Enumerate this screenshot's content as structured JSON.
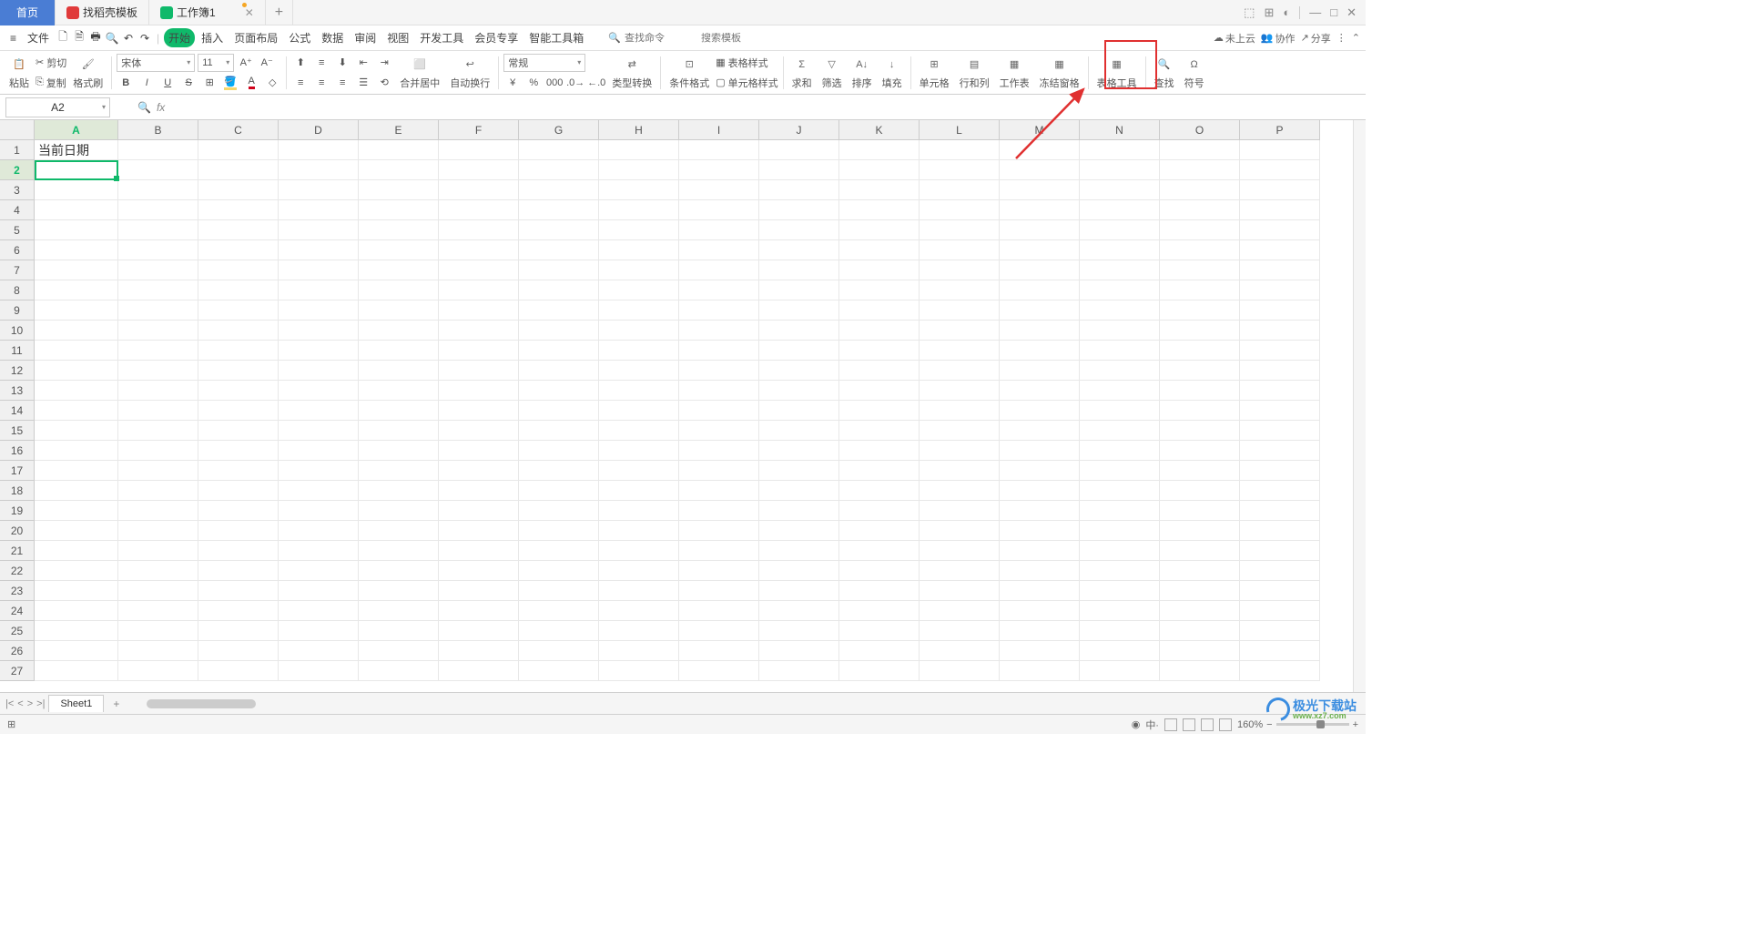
{
  "titlebar": {
    "tabs": {
      "home": "首页",
      "template_icon": "dk",
      "template": "找稻壳模板",
      "workbook_icon": "S",
      "workbook": "工作簿1",
      "add": "+"
    },
    "win": {
      "layout": "⬚",
      "grid": "⊞",
      "user": "◐",
      "min": "—",
      "max": "□",
      "close": "✕"
    }
  },
  "menubar": {
    "items": {
      "file": "文件",
      "start": "开始",
      "insert": "插入",
      "page": "页面布局",
      "formula": "公式",
      "data": "数据",
      "review": "审阅",
      "view": "视图",
      "devtools": "开发工具",
      "member": "会员专享",
      "smart": "智能工具箱"
    },
    "hamburger": "≡",
    "search": {
      "cmd_ph": "查找命令",
      "tpl_ph": "搜索模板"
    },
    "right": {
      "notcloud": "未上云",
      "collab": "协作",
      "share": "分享"
    }
  },
  "ribbon": {
    "paste": "粘贴",
    "cut": "剪切",
    "copy": "复制",
    "format_painter": "格式刷",
    "font_name": "宋体",
    "font_size": "11",
    "merge_center": "合并居中",
    "auto_wrap": "自动换行",
    "number_fmt": "常规",
    "type_convert": "类型转换",
    "cond_fmt": "条件格式",
    "table_style": "表格样式",
    "cell_style": "单元格样式",
    "sum": "求和",
    "filter": "筛选",
    "sort": "排序",
    "fill": "填充",
    "cells": "单元格",
    "rowcol": "行和列",
    "worksheet": "工作表",
    "freeze": "冻结窗格",
    "table_tools": "表格工具",
    "find": "查找",
    "symbol": "符号"
  },
  "formula_bar": {
    "cell_ref": "A2",
    "fx": "fx"
  },
  "grid": {
    "col_widths": {
      "A": 92,
      "default": 88
    },
    "columns": [
      "A",
      "B",
      "C",
      "D",
      "E",
      "F",
      "G",
      "H",
      "I",
      "J",
      "K",
      "L",
      "M",
      "N",
      "O",
      "P"
    ],
    "rows": 27,
    "selected_cell": "A2",
    "selected_row": 2,
    "selected_col": "A",
    "cells": {
      "A1": "当前日期"
    }
  },
  "sheetbar": {
    "sheet1": "Sheet1",
    "add": "+",
    "nav_first": "|<",
    "nav_prev": "<",
    "nav_next": ">",
    "nav_last": ">|"
  },
  "statusbar": {
    "ready": "⊞",
    "zoom": "160%",
    "views": [
      "⊞",
      "▤",
      "▥",
      "▦"
    ],
    "eye": "◉",
    "cn": "中·"
  },
  "watermark": {
    "text1": "极光下载站",
    "text2": "www.xz7.com"
  }
}
